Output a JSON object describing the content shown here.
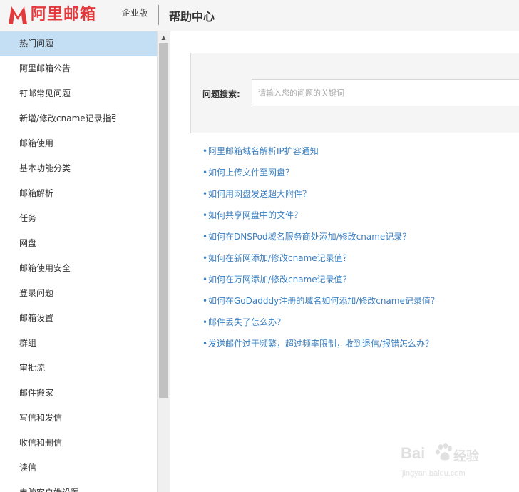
{
  "header": {
    "logo_text": "阿里邮箱",
    "edition": "企业版",
    "title": "帮助中心",
    "brand_color": "#e4393c"
  },
  "sidebar": {
    "items": [
      {
        "label": "热门问题",
        "active": true
      },
      {
        "label": "阿里邮箱公告"
      },
      {
        "label": "钉邮常见问题"
      },
      {
        "label": "新增/修改cname记录指引"
      },
      {
        "label": "邮箱使用"
      },
      {
        "label": "基本功能分类"
      },
      {
        "label": "邮箱解析"
      },
      {
        "label": "任务"
      },
      {
        "label": "网盘"
      },
      {
        "label": "邮箱使用安全"
      },
      {
        "label": "登录问题"
      },
      {
        "label": "邮箱设置"
      },
      {
        "label": "群组"
      },
      {
        "label": "审批流"
      },
      {
        "label": "邮件搬家"
      },
      {
        "label": "写信和发信"
      },
      {
        "label": "收信和删信"
      },
      {
        "label": "读信"
      },
      {
        "label": "电脑客户端设置"
      }
    ]
  },
  "search": {
    "label": "问题搜索:",
    "placeholder": "请输入您的问题的关键词"
  },
  "faq": {
    "bullet": "•",
    "links": [
      "阿里邮箱域名解析IP扩容通知",
      "如何上传文件至网盘？",
      "如何用网盘发送超大附件？",
      "如何共享网盘中的文件？",
      "如何在DNSPod域名服务商处添加/修改cname记录？",
      "如何在新网添加/修改cname记录值？",
      "如何在万网添加/修改cname记录值？",
      "如何在GoDadddy注册的域名如何添加/修改cname记录值？",
      "邮件丢失了怎么办？",
      "发送邮件过于频繁，超过频率限制，收到退信/报错怎么办？"
    ],
    "link_color": "#3a7fc1"
  },
  "watermark": {
    "brand": "Bai",
    "brand_suffix": "经验",
    "url": "jingyan.baidu.com"
  }
}
